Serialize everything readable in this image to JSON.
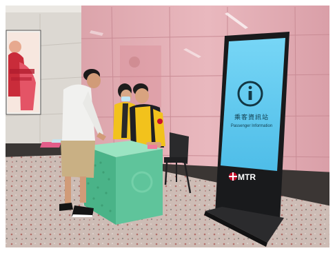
{
  "totem": {
    "screen": {
      "title": "乘客資訊站",
      "subtitle": "Passenger Information",
      "icon": "info-icon"
    },
    "brand": "MTR",
    "brand_icon": "mtr-logo-icon"
  },
  "colors": {
    "wall": "#e7b3b9",
    "screen": "#5ec8ee",
    "booth": "#5fc49b",
    "staff_vest": "#f2c21c",
    "mtr_red": "#c8102e"
  }
}
